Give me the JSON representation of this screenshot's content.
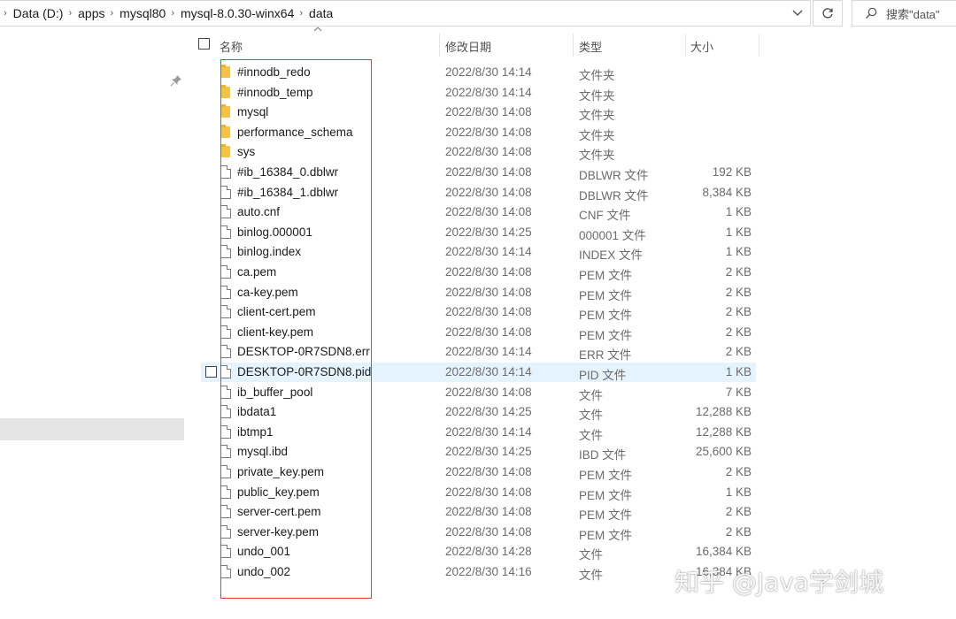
{
  "address_bar": {
    "breadcrumbs": [
      "Data (D:)",
      "apps",
      "mysql80",
      "mysql-8.0.30-winx64",
      "data"
    ]
  },
  "search": {
    "placeholder": "搜索\"data\""
  },
  "columns": {
    "name": "名称",
    "date": "修改日期",
    "type": "类型",
    "size": "大小"
  },
  "files": [
    {
      "name": "#innodb_redo",
      "date": "2022/8/30 14:14",
      "type": "文件夹",
      "size": "",
      "icon": "folder-icon"
    },
    {
      "name": "#innodb_temp",
      "date": "2022/8/30 14:14",
      "type": "文件夹",
      "size": "",
      "icon": "folder-icon"
    },
    {
      "name": "mysql",
      "date": "2022/8/30 14:08",
      "type": "文件夹",
      "size": "",
      "icon": "folder-icon"
    },
    {
      "name": "performance_schema",
      "date": "2022/8/30 14:08",
      "type": "文件夹",
      "size": "",
      "icon": "folder-icon"
    },
    {
      "name": "sys",
      "date": "2022/8/30 14:08",
      "type": "文件夹",
      "size": "",
      "icon": "folder-icon"
    },
    {
      "name": "#ib_16384_0.dblwr",
      "date": "2022/8/30 14:08",
      "type": "DBLWR 文件",
      "size": "192 KB",
      "icon": "file-icon"
    },
    {
      "name": "#ib_16384_1.dblwr",
      "date": "2022/8/30 14:08",
      "type": "DBLWR 文件",
      "size": "8,384 KB",
      "icon": "file-icon"
    },
    {
      "name": "auto.cnf",
      "date": "2022/8/30 14:08",
      "type": "CNF 文件",
      "size": "1 KB",
      "icon": "file-icon"
    },
    {
      "name": "binlog.000001",
      "date": "2022/8/30 14:25",
      "type": "000001 文件",
      "size": "1 KB",
      "icon": "file-icon"
    },
    {
      "name": "binlog.index",
      "date": "2022/8/30 14:14",
      "type": "INDEX 文件",
      "size": "1 KB",
      "icon": "file-icon"
    },
    {
      "name": "ca.pem",
      "date": "2022/8/30 14:08",
      "type": "PEM 文件",
      "size": "2 KB",
      "icon": "file-icon"
    },
    {
      "name": "ca-key.pem",
      "date": "2022/8/30 14:08",
      "type": "PEM 文件",
      "size": "2 KB",
      "icon": "file-icon"
    },
    {
      "name": "client-cert.pem",
      "date": "2022/8/30 14:08",
      "type": "PEM 文件",
      "size": "2 KB",
      "icon": "file-icon"
    },
    {
      "name": "client-key.pem",
      "date": "2022/8/30 14:08",
      "type": "PEM 文件",
      "size": "2 KB",
      "icon": "file-icon"
    },
    {
      "name": "DESKTOP-0R7SDN8.err",
      "date": "2022/8/30 14:14",
      "type": "ERR 文件",
      "size": "2 KB",
      "icon": "file-icon"
    },
    {
      "name": "DESKTOP-0R7SDN8.pid",
      "date": "2022/8/30 14:14",
      "type": "PID 文件",
      "size": "1 KB",
      "icon": "file-icon",
      "hovered": true
    },
    {
      "name": "ib_buffer_pool",
      "date": "2022/8/30 14:08",
      "type": "文件",
      "size": "7 KB",
      "icon": "file-icon"
    },
    {
      "name": "ibdata1",
      "date": "2022/8/30 14:25",
      "type": "文件",
      "size": "12,288 KB",
      "icon": "file-icon"
    },
    {
      "name": "ibtmp1",
      "date": "2022/8/30 14:14",
      "type": "文件",
      "size": "12,288 KB",
      "icon": "file-icon"
    },
    {
      "name": "mysql.ibd",
      "date": "2022/8/30 14:25",
      "type": "IBD 文件",
      "size": "25,600 KB",
      "icon": "file-icon"
    },
    {
      "name": "private_key.pem",
      "date": "2022/8/30 14:08",
      "type": "PEM 文件",
      "size": "2 KB",
      "icon": "file-icon"
    },
    {
      "name": "public_key.pem",
      "date": "2022/8/30 14:08",
      "type": "PEM 文件",
      "size": "1 KB",
      "icon": "file-icon"
    },
    {
      "name": "server-cert.pem",
      "date": "2022/8/30 14:08",
      "type": "PEM 文件",
      "size": "2 KB",
      "icon": "file-icon"
    },
    {
      "name": "server-key.pem",
      "date": "2022/8/30 14:08",
      "type": "PEM 文件",
      "size": "2 KB",
      "icon": "file-icon"
    },
    {
      "name": "undo_001",
      "date": "2022/8/30 14:28",
      "type": "文件",
      "size": "16,384 KB",
      "icon": "file-icon"
    },
    {
      "name": "undo_002",
      "date": "2022/8/30 14:16",
      "type": "文件",
      "size": "16,384 KB",
      "icon": "file-icon"
    }
  ],
  "watermark": "知乎 @Java学剑城",
  "colors": {
    "hover_row": "#e5f3ff",
    "highlight_box": "#e53b3b",
    "folder": "#f5c243",
    "nav_selected": "#e5e5e5"
  }
}
